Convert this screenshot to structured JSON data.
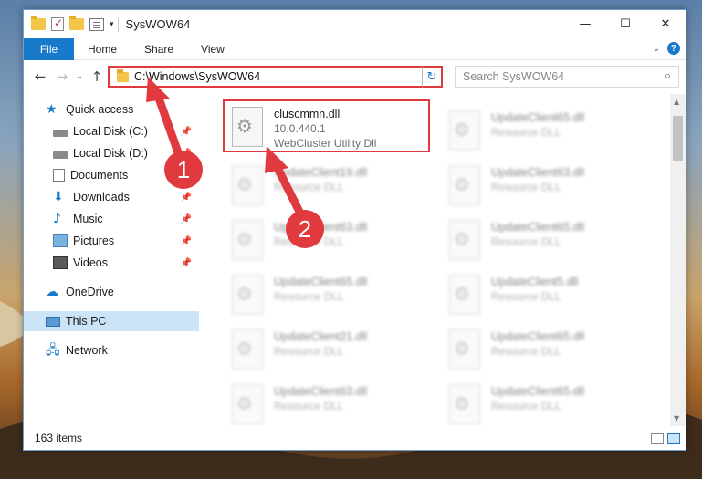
{
  "window": {
    "title": "SysWOW64",
    "controls": {
      "minimize": "—",
      "maximize": "☐",
      "close": "✕"
    }
  },
  "ribbon": {
    "tabs": [
      "File",
      "Home",
      "Share",
      "View"
    ]
  },
  "navigation": {
    "back": "←",
    "forward": "→",
    "recent": "⌄",
    "up": "↑",
    "address": "C:\\Windows\\SysWOW64",
    "refresh": "↻",
    "search_placeholder": "Search SysWOW64"
  },
  "sidebar": {
    "items": [
      {
        "label": "Quick access",
        "icon": "star-icon",
        "pinned": false
      },
      {
        "label": "Local Disk (C:)",
        "icon": "disk-icon",
        "pinned": true
      },
      {
        "label": "Local Disk (D:)",
        "icon": "disk-icon",
        "pinned": true
      },
      {
        "label": "Documents",
        "icon": "documents-icon",
        "pinned": false
      },
      {
        "label": "Downloads",
        "icon": "downloads-icon",
        "pinned": true
      },
      {
        "label": "Music",
        "icon": "music-icon",
        "pinned": true
      },
      {
        "label": "Pictures",
        "icon": "pictures-icon",
        "pinned": true
      },
      {
        "label": "Videos",
        "icon": "videos-icon",
        "pinned": true
      },
      {
        "label": "OneDrive",
        "icon": "onedrive-icon",
        "pinned": false
      },
      {
        "label": "This PC",
        "icon": "this-pc-icon",
        "pinned": false,
        "selected": true
      },
      {
        "label": "Network",
        "icon": "network-icon",
        "pinned": false
      }
    ]
  },
  "files": [
    {
      "name": "cluscmmn.dll",
      "version": "10.0.440.1",
      "description": "WebCluster Utility Dll",
      "highlighted": true
    },
    {
      "name": "UpdateClient65.dll",
      "description": "Resource DLL"
    },
    {
      "name": "UpdateClient19.dll",
      "description": "Resource DLL"
    },
    {
      "name": "UpdateClient63.dll",
      "description": "Resource DLL"
    },
    {
      "name": "UpdateClient63.dll",
      "description": "Resource DLL"
    },
    {
      "name": "UpdateClient65.dll",
      "description": "Resource DLL"
    },
    {
      "name": "UpdateClient65.dll",
      "description": "Resource DLL"
    },
    {
      "name": "UpdateClient5.dll",
      "description": "Resource DLL"
    },
    {
      "name": "UpdateClient21.dll",
      "description": "Resource DLL"
    },
    {
      "name": "UpdateClient65.dll",
      "description": "Resource DLL"
    },
    {
      "name": "UpdateClient63.dll",
      "description": "Resource DLL"
    },
    {
      "name": "UpdateClient65.dll",
      "description": "Resource DLL"
    }
  ],
  "status": {
    "item_count": "163 items"
  },
  "annotations": {
    "step1": "1",
    "step2": "2",
    "color": "#e0393e"
  }
}
